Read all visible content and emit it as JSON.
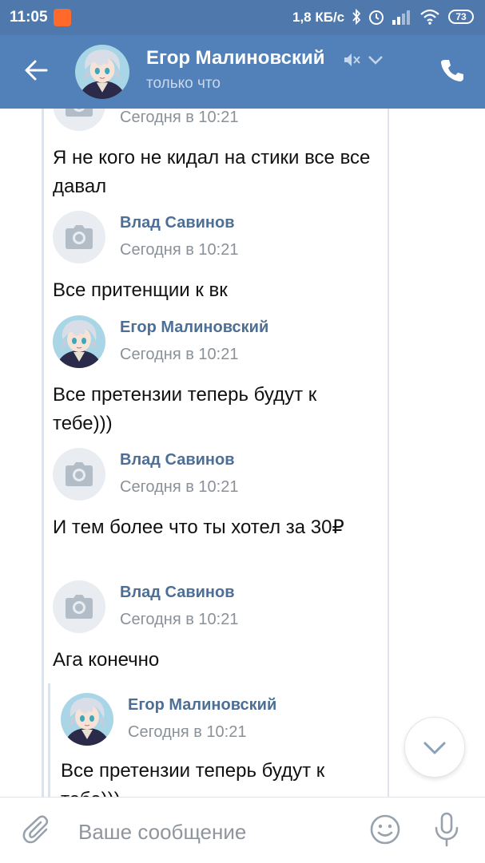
{
  "status_bar": {
    "time": "11:05",
    "speed": "1,8 КБ/с",
    "battery": "73"
  },
  "header": {
    "name": "Егор Малиновский",
    "status": "только что"
  },
  "messages": [
    {
      "author": "",
      "time": "Сегодня в 10:21",
      "text": "Я не кого не кидал на стики все все давал"
    },
    {
      "author": "Влад Савинов",
      "time": "Сегодня в 10:21",
      "text": "Все притенщии к вк"
    },
    {
      "author": "Егор Малиновский",
      "time": "Сегодня в 10:21",
      "text": "Все претензии теперь будут к тебе)))"
    },
    {
      "author": "Влад Савинов",
      "time": "Сегодня в 10:21",
      "text": "И тем более что ты хотел за 30₽"
    },
    {
      "author": "Влад Савинов",
      "time": "Сегодня в 10:21",
      "text": "Ага конечно"
    },
    {
      "author": "Егор Малиновский",
      "time": "Сегодня в 10:21",
      "text": "Все претензии теперь будут к тебе)))"
    }
  ],
  "composer": {
    "placeholder": "Ваше сообщение"
  },
  "colors": {
    "header_bg": "#5181b8",
    "status_bg": "#4f79ad",
    "author_link": "#4d6f96",
    "meta_gray": "#8a9199"
  },
  "icons": [
    "back-arrow-icon",
    "mute-icon",
    "chevron-down-icon",
    "phone-icon",
    "camera-icon",
    "paperclip-icon",
    "smile-icon",
    "microphone-icon",
    "wifi-icon",
    "signal-icon",
    "bluetooth-icon",
    "alarm-icon"
  ]
}
